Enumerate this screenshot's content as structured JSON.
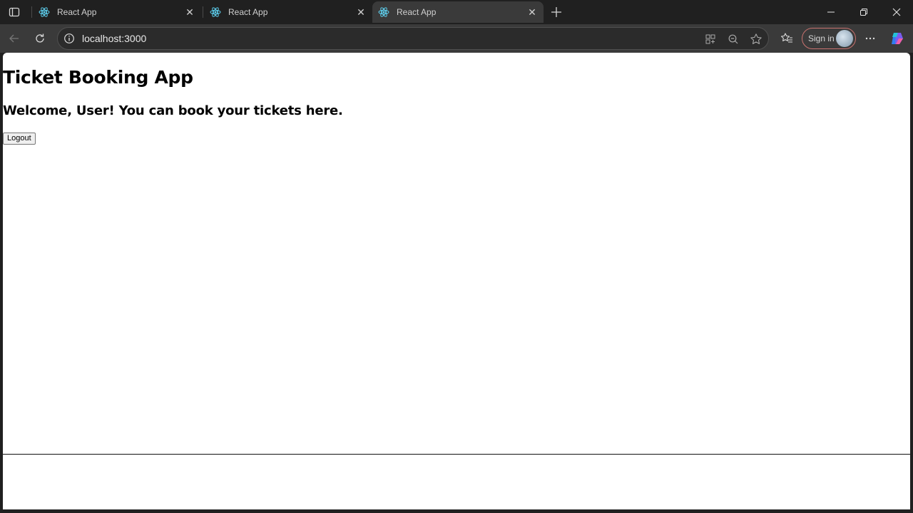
{
  "browser": {
    "tabs": [
      {
        "title": "React App",
        "active": false
      },
      {
        "title": "React App",
        "active": false
      },
      {
        "title": "React App",
        "active": true
      }
    ],
    "address": "localhost:3000",
    "signin_label": "Sign in",
    "theme": {
      "tab_bg": "#202020",
      "toolbar_bg": "#3a3a3a",
      "accent_react": "#61dafb",
      "signin_border": "#c9726f"
    }
  },
  "page": {
    "title": "Ticket Booking App",
    "welcome": "Welcome, User! You can book your tickets here.",
    "logout_label": "Logout"
  }
}
